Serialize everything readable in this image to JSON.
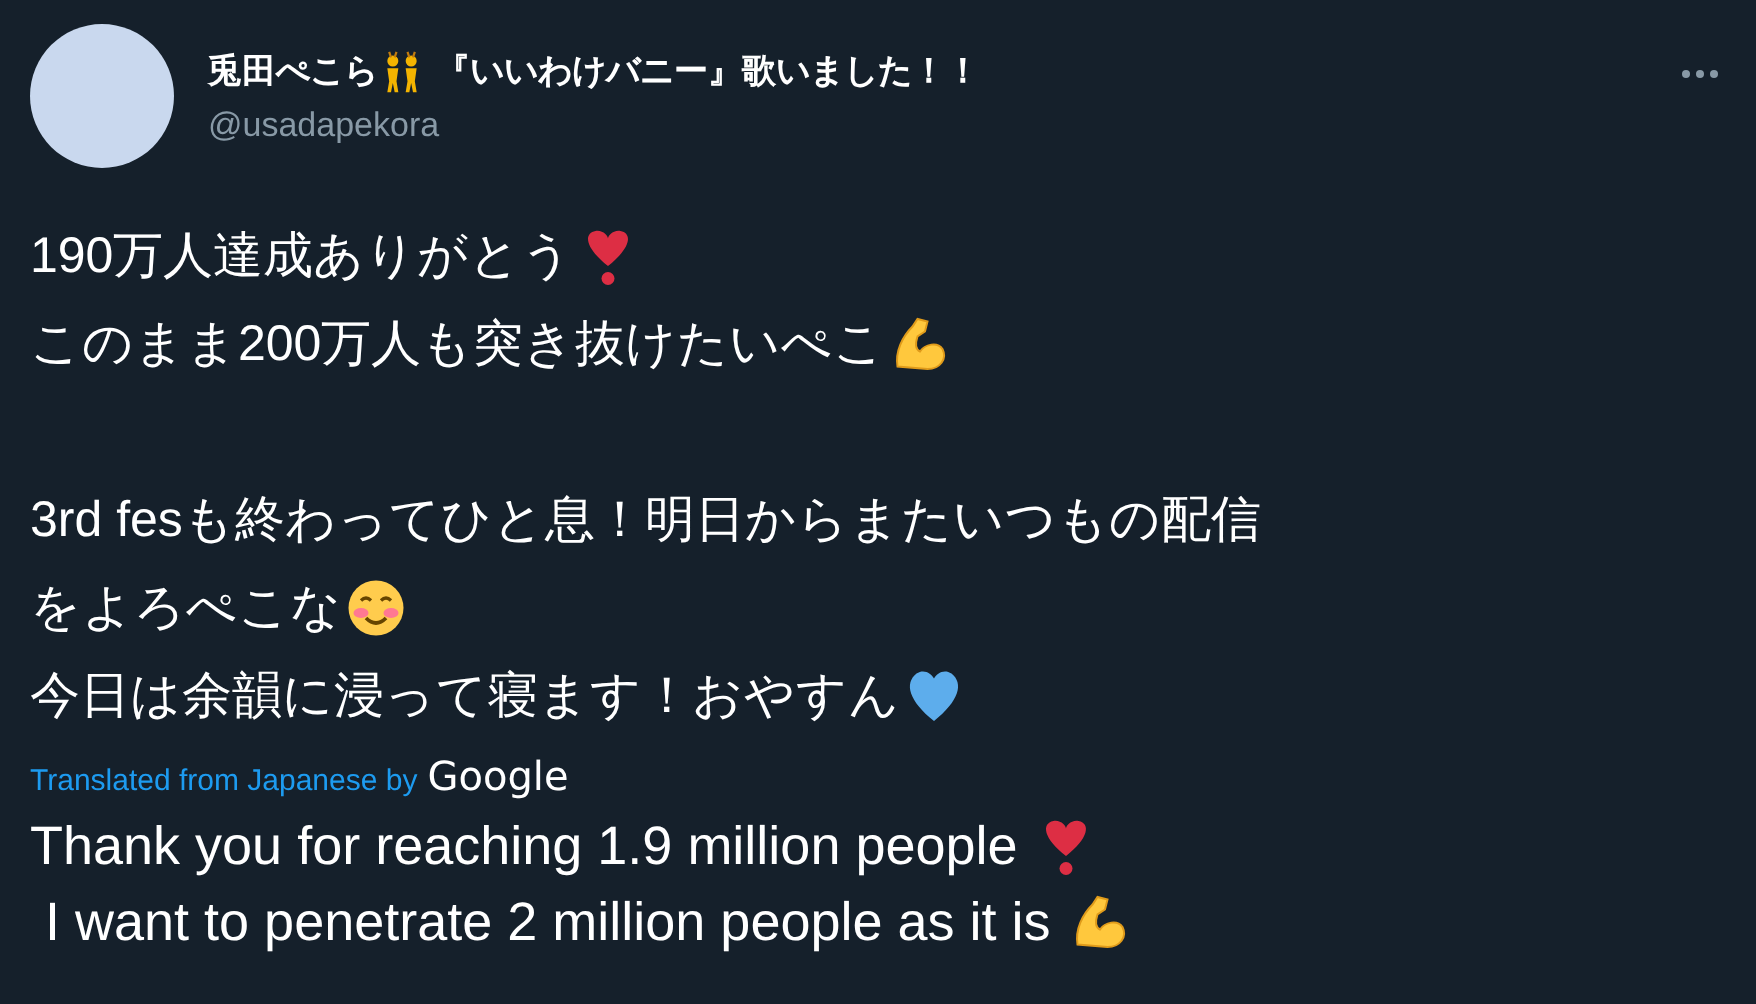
{
  "author": {
    "display_name": [
      {
        "kind": "text",
        "text": "兎田ぺこら"
      },
      {
        "kind": "dancers"
      },
      {
        "kind": "text",
        "text": "『いいわけバニー』歌いました！！"
      }
    ],
    "handle": "@usadapekora"
  },
  "tweet": {
    "paragraphs": [
      [
        [
          {
            "kind": "text",
            "text": "190万人達成ありがとう"
          },
          {
            "kind": "heart-exclamation"
          }
        ],
        [
          {
            "kind": "text",
            "text": "このまま200万人も突き抜けたいぺこ"
          },
          {
            "kind": "flexed-arm"
          }
        ]
      ],
      [
        [
          {
            "kind": "text",
            "text": "3rd fesも終わってひと息！明日からまたいつもの配信"
          }
        ],
        [
          {
            "kind": "text",
            "text": "をよろぺこな"
          },
          {
            "kind": "blushing-smile"
          }
        ],
        [
          {
            "kind": "text",
            "text": "今日は余韻に浸って寝ます！おやすん"
          },
          {
            "kind": "blue-heart"
          }
        ]
      ]
    ]
  },
  "translation": {
    "label": "Translated from Japanese by",
    "provider": "Google",
    "lines": [
      [
        {
          "kind": "text",
          "text": "Thank you for reaching 1.9 million people "
        },
        {
          "kind": "heart-exclamation"
        }
      ],
      [
        {
          "kind": "text",
          "text": " I want to penetrate 2 million people as it is "
        },
        {
          "kind": "flexed-arm"
        }
      ]
    ]
  }
}
